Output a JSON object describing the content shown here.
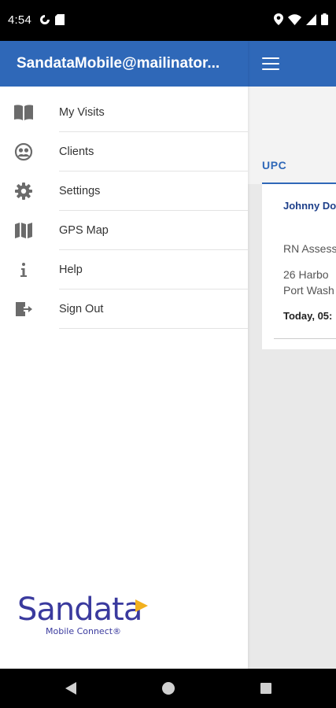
{
  "status_bar": {
    "time": "4:54",
    "left_icons": [
      "app-notification-icon",
      "sd-card-icon"
    ],
    "right_icons": [
      "location-icon",
      "wifi-icon",
      "signal-icon",
      "battery-icon"
    ]
  },
  "drawer": {
    "account_email": "SandataMobile@mailinator...",
    "items": [
      {
        "label": "My Visits",
        "icon": "book-icon"
      },
      {
        "label": "Clients",
        "icon": "clients-icon"
      },
      {
        "label": "Settings",
        "icon": "gear-icon"
      },
      {
        "label": "GPS Map",
        "icon": "map-icon"
      },
      {
        "label": "Help",
        "icon": "info-icon"
      },
      {
        "label": "Sign Out",
        "icon": "sign-out-icon"
      }
    ],
    "logo": {
      "text": "Sandata",
      "subtitle": "Mobile Connect®"
    }
  },
  "background": {
    "tab_label": "UPC",
    "visit": {
      "client_name": "Johnny Do",
      "service": "RN Assess",
      "address_line1": "26 Harbo",
      "address_line2": "Port Wash",
      "time": "Today, 05:"
    }
  },
  "colors": {
    "brand_blue": "#2f68b8",
    "logo_purple": "#3a3a9e",
    "logo_accent": "#f2b01e"
  },
  "nav_bar": {
    "buttons": [
      "back-icon",
      "home-icon",
      "recents-icon"
    ]
  }
}
